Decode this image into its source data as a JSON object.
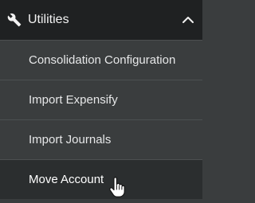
{
  "section": {
    "title": "Utilities",
    "icon": "wrench-icon",
    "toggle_icon": "chevron-up-icon",
    "expanded": true
  },
  "items": [
    {
      "label": "Consolidation Configuration"
    },
    {
      "label": "Import Expensify"
    },
    {
      "label": "Import Journals"
    },
    {
      "label": "Move Account",
      "hovered": true
    }
  ],
  "colors": {
    "header_bg": "#1f2122",
    "menu_bg": "#3a3d3e",
    "hover_bg": "#2b2e2f",
    "text": "#e6e7e8"
  },
  "cursor": "pointer-hand-icon"
}
